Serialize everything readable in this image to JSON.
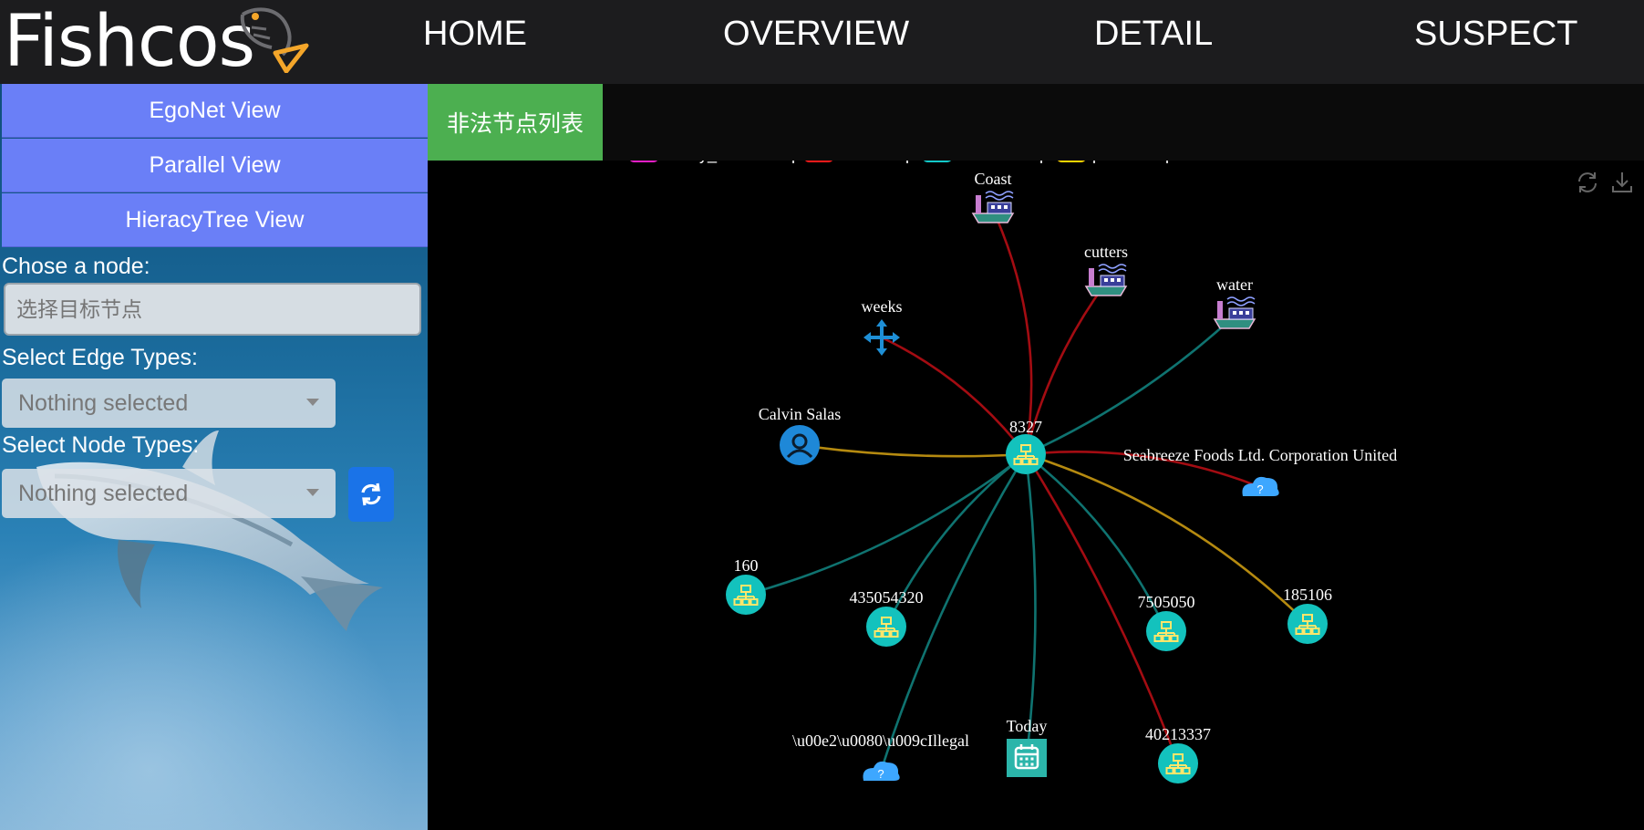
{
  "brand": {
    "name": "Fishcos",
    "logo_icon": "fish-logo-icon"
  },
  "nav": [
    {
      "label": "HOME"
    },
    {
      "label": "OVERVIEW"
    },
    {
      "label": "DETAIL"
    },
    {
      "label": "SUSPECT"
    }
  ],
  "sidebar": {
    "views": [
      {
        "label": "EgoNet View"
      },
      {
        "label": "Parallel View"
      },
      {
        "label": "HieracyTree View"
      }
    ],
    "node_label": "Chose a node:",
    "node_placeholder": "选择目标节点",
    "edge_types_label": "Select Edge Types:",
    "edge_types_value": "Nothing selected",
    "node_types_label": "Select Node Types:",
    "node_types_value": "Nothing selected",
    "refresh_icon": "refresh-icon",
    "accent_color": "#6a7ff7"
  },
  "main": {
    "illegal_list_button": "非法节点列表",
    "tools": {
      "restore_icon": "restore-icon",
      "download_icon": "download-icon"
    }
  },
  "graph": {
    "legend": [
      {
        "label": "family_relationship",
        "color": "#e91ec8"
      },
      {
        "label": "ownership",
        "color": "#ff1a1a"
      },
      {
        "label": "membership",
        "color": "#12c9c9"
      },
      {
        "label": "partnership",
        "color": "#ffd500"
      }
    ],
    "center": "8327",
    "nodes": [
      {
        "id": "8327",
        "label": "8327",
        "type": "company"
      },
      {
        "id": "coast",
        "label": "Coast",
        "type": "vessel"
      },
      {
        "id": "cutters",
        "label": "cutters",
        "type": "vessel"
      },
      {
        "id": "water",
        "label": "water",
        "type": "vessel"
      },
      {
        "id": "weeks",
        "label": "weeks",
        "type": "movement"
      },
      {
        "id": "calvin",
        "label": "Calvin Salas",
        "type": "person"
      },
      {
        "id": "seabreeze",
        "label": "Seabreeze Foods Ltd. Corporation United",
        "type": "unknown"
      },
      {
        "id": "160",
        "label": "160",
        "type": "company"
      },
      {
        "id": "435054320",
        "label": "435054320",
        "type": "company"
      },
      {
        "id": "7505050",
        "label": "7505050",
        "type": "company"
      },
      {
        "id": "185106",
        "label": "185106",
        "type": "company"
      },
      {
        "id": "illegal",
        "label": "\\u00e2\\u0080\\u009cIllegal",
        "type": "unknown"
      },
      {
        "id": "today",
        "label": "Today",
        "type": "event"
      },
      {
        "id": "40213337",
        "label": "40213337",
        "type": "company"
      }
    ],
    "edges": [
      {
        "to": "coast",
        "type": "ownership"
      },
      {
        "to": "cutters",
        "type": "ownership"
      },
      {
        "to": "water",
        "type": "membership"
      },
      {
        "to": "weeks",
        "type": "ownership"
      },
      {
        "to": "calvin",
        "type": "partnership"
      },
      {
        "to": "seabreeze",
        "type": "ownership"
      },
      {
        "to": "160",
        "type": "membership"
      },
      {
        "to": "435054320",
        "type": "membership"
      },
      {
        "to": "7505050",
        "type": "membership"
      },
      {
        "to": "185106",
        "type": "partnership"
      },
      {
        "to": "illegal",
        "type": "membership"
      },
      {
        "to": "today",
        "type": "membership"
      },
      {
        "to": "40213337",
        "type": "ownership"
      }
    ]
  }
}
